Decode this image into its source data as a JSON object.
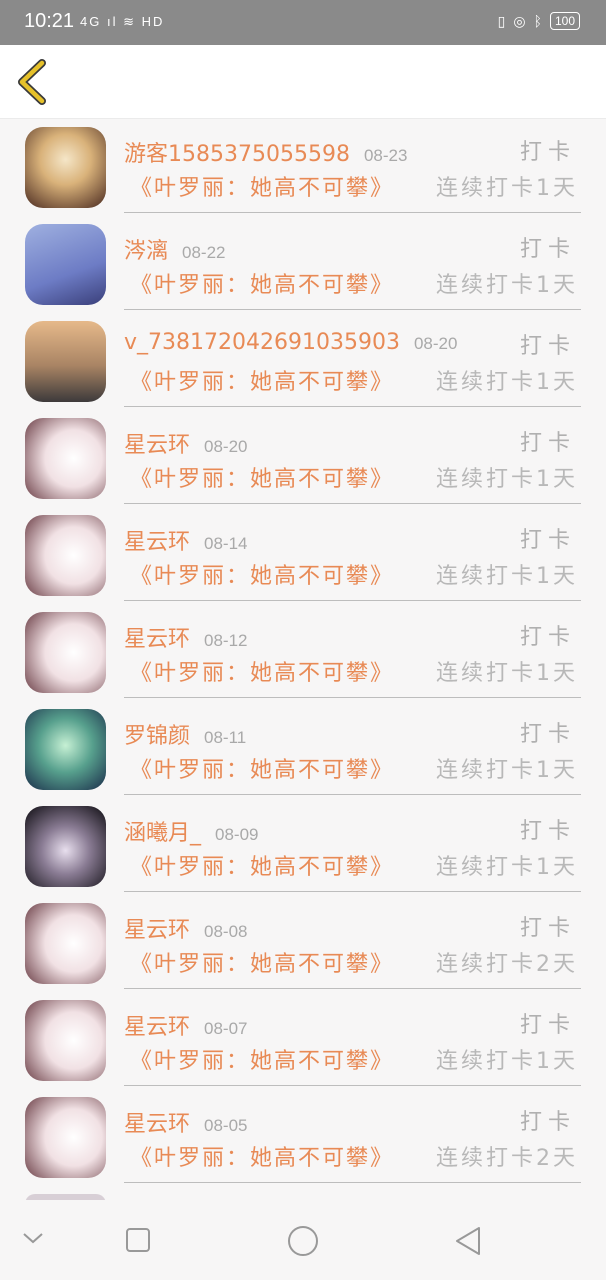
{
  "status_bar": {
    "time": "10:21",
    "left_icons": "4G ıl ≋ HD",
    "battery": "100"
  },
  "header": {
    "back_icon": "chevron-left-icon"
  },
  "rows": [
    {
      "name": "游客1585375055598",
      "date": "08-23",
      "action": "打卡",
      "book": "《叶罗丽：她高不可攀》",
      "streak": "连续打卡1天",
      "avatar": "av-portrait"
    },
    {
      "name": "涔漓",
      "date": "08-22",
      "action": "打卡",
      "book": "《叶罗丽：她高不可攀》",
      "streak": "连续打卡1天",
      "avatar": "av-blue"
    },
    {
      "name": "v_738172042691035903",
      "date": "08-20",
      "action": "打卡",
      "book": "《叶罗丽：她高不可攀》",
      "streak": "连续打卡1天",
      "avatar": "av-city"
    },
    {
      "name": "星云环",
      "date": "08-20",
      "action": "打卡",
      "book": "《叶罗丽：她高不可攀》",
      "streak": "连续打卡1天",
      "avatar": "av-girl"
    },
    {
      "name": "星云环",
      "date": "08-14",
      "action": "打卡",
      "book": "《叶罗丽：她高不可攀》",
      "streak": "连续打卡1天",
      "avatar": "av-girl"
    },
    {
      "name": "星云环",
      "date": "08-12",
      "action": "打卡",
      "book": "《叶罗丽：她高不可攀》",
      "streak": "连续打卡1天",
      "avatar": "av-girl"
    },
    {
      "name": "罗锦颜",
      "date": "08-11",
      "action": "打卡",
      "book": "《叶罗丽：她高不可攀》",
      "streak": "连续打卡1天",
      "avatar": "av-green"
    },
    {
      "name": "涵曦月_",
      "date": "08-09",
      "action": "打卡",
      "book": "《叶罗丽：她高不可攀》",
      "streak": "连续打卡1天",
      "avatar": "av-ghost"
    },
    {
      "name": "星云环",
      "date": "08-08",
      "action": "打卡",
      "book": "《叶罗丽：她高不可攀》",
      "streak": "连续打卡2天",
      "avatar": "av-girl"
    },
    {
      "name": "星云环",
      "date": "08-07",
      "action": "打卡",
      "book": "《叶罗丽：她高不可攀》",
      "streak": "连续打卡1天",
      "avatar": "av-girl"
    },
    {
      "name": "星云环",
      "date": "08-05",
      "action": "打卡",
      "book": "《叶罗丽：她高不可攀》",
      "streak": "连续打卡2天",
      "avatar": "av-girl"
    }
  ],
  "nav": {
    "down_icon": "chevron-down-icon",
    "recents_icon": "square-icon",
    "home_icon": "circle-icon",
    "back_icon": "triangle-back-icon"
  },
  "colors": {
    "accent_orange": "#e88a55",
    "back_yellow": "#e6c12a",
    "muted_gray": "#b0b0b0",
    "status_bar_gray": "#8a8a8a"
  }
}
